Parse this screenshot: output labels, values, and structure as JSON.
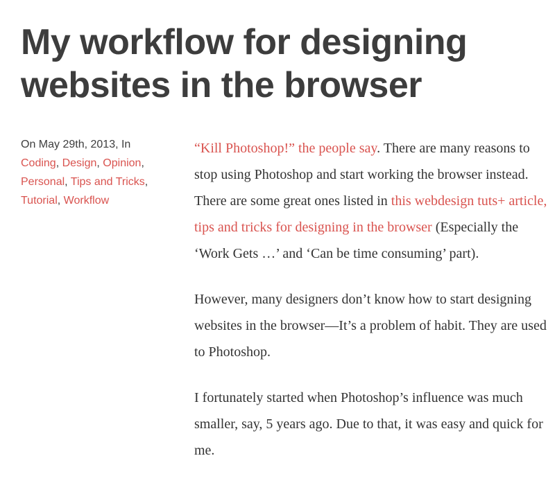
{
  "title": "My workflow for designing websites in the browser",
  "meta": {
    "prefix": "On  ",
    "date": "May 29th, 2013",
    "in": ", In",
    "categories": [
      "Coding",
      "Design",
      "Opinion",
      "Personal",
      "Tips and Tricks",
      "Tutorial",
      "Workflow"
    ]
  },
  "body": {
    "p1_link1": "“Kill Photoshop!” the people say",
    "p1_text1": ". There are many reasons to stop using Photoshop and start working the browser instead. There are some great ones listed in ",
    "p1_link2": "this webdesign tuts+ article, tips and tricks for designing in the browser",
    "p1_text2": " (Especially the ‘Work Gets …’ and ‘Can be time consuming’ part).",
    "p2": "However, many designers don’t know how to start designing websites in the browser—It’s a problem of habit. They are used to Photoshop.",
    "p3": "I fortunately started when Photoshop’s influence was much smaller, say, 5 years ago. Due to that, it was easy and quick for me."
  }
}
